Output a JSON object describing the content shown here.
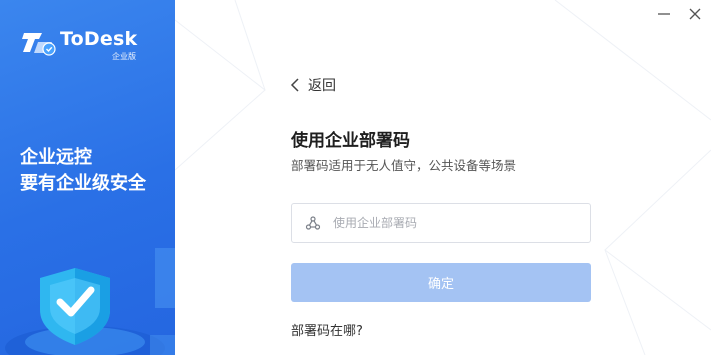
{
  "brand": {
    "name": "ToDesk",
    "edition": "企业版"
  },
  "slogan": {
    "line1": "企业远控",
    "line2": "要有企业级安全"
  },
  "window_controls": {
    "minimize_icon": "minimize-icon",
    "close_icon": "close-icon"
  },
  "form": {
    "back_label": "返回",
    "title": "使用企业部署码",
    "subtitle": "部署码适用于无人值守，公共设备等场景",
    "input_placeholder": "使用企业部署码",
    "input_value": "",
    "confirm_label": "确定",
    "help_link": "部署码在哪?"
  },
  "colors": {
    "panel_blue": "#2a70e6",
    "button_disabled": "#a4c3f3",
    "input_border": "#dcdfe6"
  }
}
